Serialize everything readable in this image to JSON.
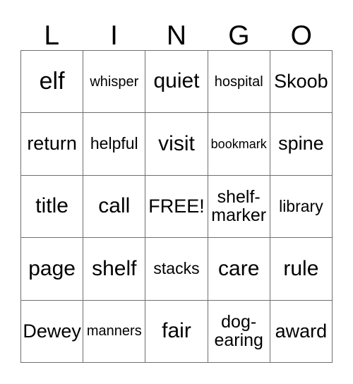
{
  "card": {
    "header_letters": [
      "L",
      "I",
      "N",
      "G",
      "O"
    ],
    "rows": [
      [
        {
          "text": "elf",
          "size": "fs-xl"
        },
        {
          "text": "whisper",
          "size": "fs-xs"
        },
        {
          "text": "quiet",
          "size": "fs-lg"
        },
        {
          "text": "hospital",
          "size": "fs-xs"
        },
        {
          "text": "Skoob",
          "size": "fs-md"
        }
      ],
      [
        {
          "text": "return",
          "size": "fs-md"
        },
        {
          "text": "helpful",
          "size": "fs-sm"
        },
        {
          "text": "visit",
          "size": "fs-lg"
        },
        {
          "text": "bookmark",
          "size": "fs-xxs"
        },
        {
          "text": "spine",
          "size": "fs-md"
        }
      ],
      [
        {
          "text": "title",
          "size": "fs-lg"
        },
        {
          "text": "call",
          "size": "fs-lg"
        },
        {
          "text": "FREE!",
          "size": "fs-md"
        },
        {
          "text": "shelf-\nmarker",
          "size": "two-line"
        },
        {
          "text": "library",
          "size": "fs-sm"
        }
      ],
      [
        {
          "text": "page",
          "size": "fs-lg"
        },
        {
          "text": "shelf",
          "size": "fs-lg"
        },
        {
          "text": "stacks",
          "size": "fs-sm"
        },
        {
          "text": "care",
          "size": "fs-lg"
        },
        {
          "text": "rule",
          "size": "fs-lg"
        }
      ],
      [
        {
          "text": "Dewey",
          "size": "fs-md"
        },
        {
          "text": "manners",
          "size": "fs-xs"
        },
        {
          "text": "fair",
          "size": "fs-lg"
        },
        {
          "text": "dog-\nearing",
          "size": "two-line"
        },
        {
          "text": "award",
          "size": "fs-md"
        }
      ]
    ]
  },
  "colors": {
    "grid_line": "#6f6f6f",
    "text": "#000000",
    "background": "#ffffff"
  }
}
